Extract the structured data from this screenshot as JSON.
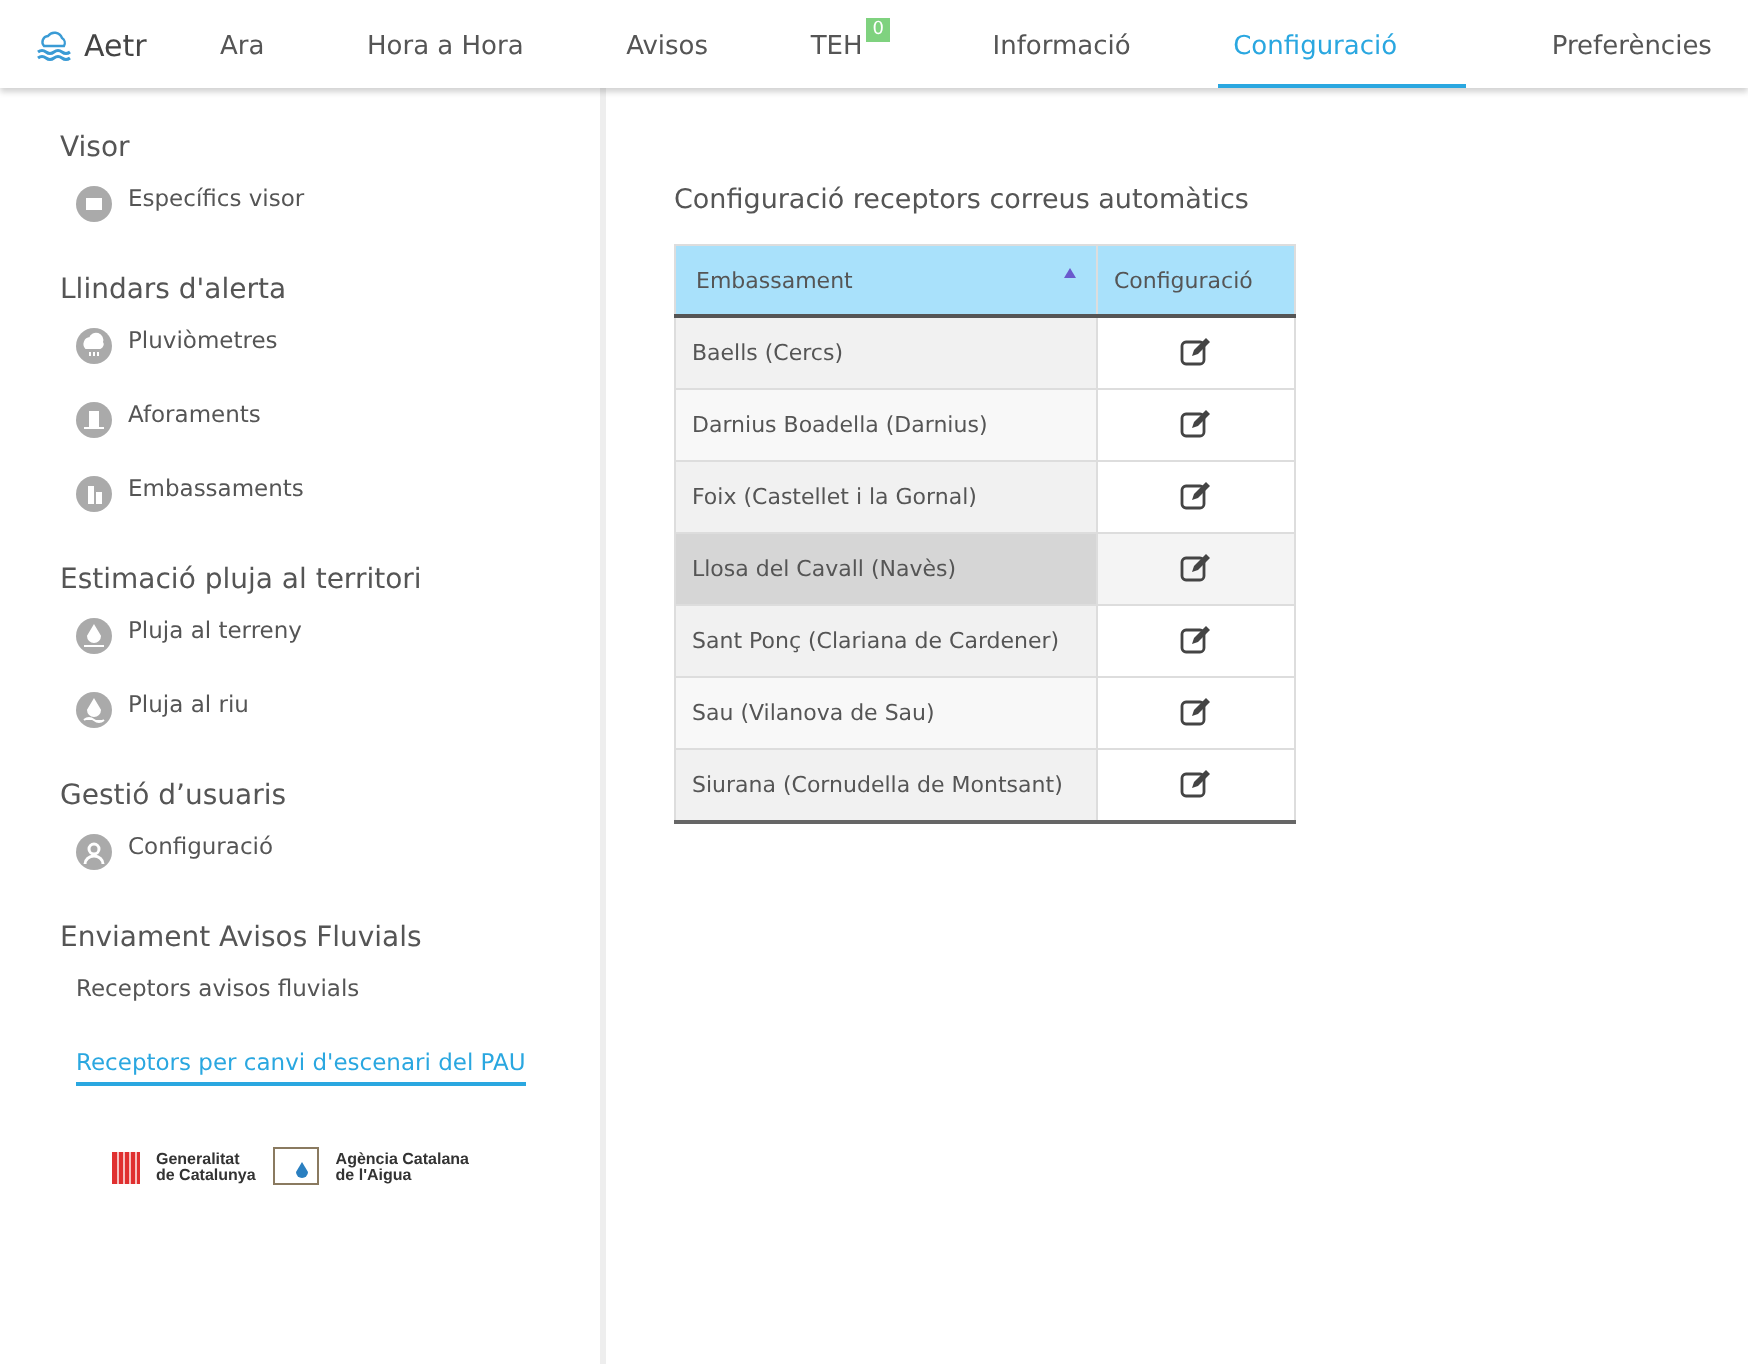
{
  "header": {
    "brand": "Aetr",
    "tabs": [
      {
        "label": "Ara",
        "selected": false
      },
      {
        "label": "Hora a Hora",
        "selected": false
      },
      {
        "label": "Avisos",
        "selected": false
      },
      {
        "label": "TEH",
        "selected": false,
        "badge": "0"
      },
      {
        "label": "Informació",
        "selected": false
      },
      {
        "label": "Configuració",
        "selected": true
      },
      {
        "label": "Preferències",
        "selected": false
      }
    ]
  },
  "sidebar": {
    "sections": [
      {
        "title": "Visor",
        "items": [
          {
            "label": "Específics visor",
            "kind": "monitor",
            "selected": false
          }
        ]
      },
      {
        "title": "Llindars d'alerta",
        "items": [
          {
            "label": "Pluviòmetres",
            "kind": "rain",
            "selected": false
          },
          {
            "label": "Aforaments",
            "kind": "gauge",
            "selected": false
          },
          {
            "label": "Embassaments",
            "kind": "dam",
            "selected": false
          }
        ]
      },
      {
        "title": "Estimació pluja al territori",
        "items": [
          {
            "label": "Pluja al terreny",
            "kind": "drop",
            "selected": false
          },
          {
            "label": "Pluja al riu",
            "kind": "river",
            "selected": false
          }
        ]
      },
      {
        "title": "Gestió d’usuaris",
        "items": [
          {
            "label": "Configuració",
            "kind": "user",
            "selected": false
          }
        ]
      },
      {
        "title": "Enviament Avisos Fluvials",
        "items": [
          {
            "label": "Receptors avisos fluvials",
            "kind": "plain",
            "selected": false
          },
          {
            "label": "Receptors per canvi d'escenari del PAU",
            "kind": "plain",
            "selected": true
          }
        ]
      }
    ],
    "logos": {
      "generalitat": "Generalitat\nde Catalunya",
      "agencia": "Agència Catalana\nde l'Aigua"
    }
  },
  "main": {
    "title": "Configuració receptors correus automàtics",
    "table": {
      "columns": [
        "Embassament",
        "Configuració"
      ],
      "rows": [
        {
          "name": "Baells (Cercs)",
          "hovered": false
        },
        {
          "name": "Darnius Boadella (Darnius)",
          "hovered": false
        },
        {
          "name": "Foix (Castellet i la Gornal)",
          "hovered": false
        },
        {
          "name": "Llosa del Cavall (Navès)",
          "hovered": true
        },
        {
          "name": "Sant Ponç (Clariana de Cardener)",
          "hovered": false
        },
        {
          "name": "Sau (Vilanova de Sau)",
          "hovered": false
        },
        {
          "name": "Siurana (Cornudella de Montsant)",
          "hovered": false
        }
      ]
    }
  }
}
